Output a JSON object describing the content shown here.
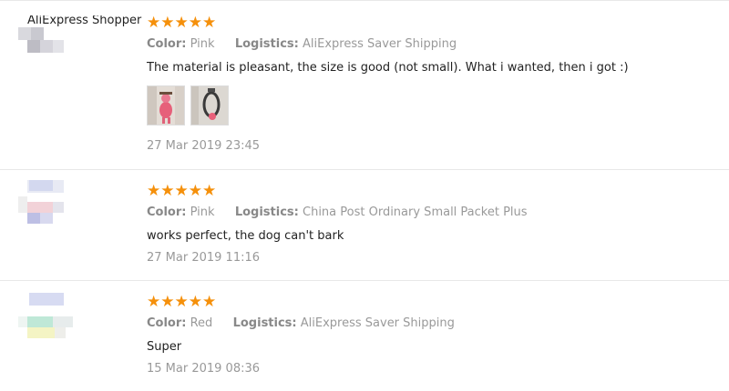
{
  "reviews": [
    {
      "reviewer": "AliExpress Shopper",
      "stars": "★★★★★",
      "color_label": "Color:",
      "color_value": "Pink",
      "logistics_label": "Logistics:",
      "logistics_value": "AliExpress Saver Shipping",
      "text": "The material is pleasant, the size is good (not small). What i wanted, then i got :)",
      "photos": [
        "photo-1",
        "photo-2"
      ],
      "date": "27 Mar 2019 23:45"
    },
    {
      "stars": "★★★★★",
      "color_label": "Color:",
      "color_value": "Pink",
      "logistics_label": "Logistics:",
      "logistics_value": "China Post Ordinary Small Packet Plus",
      "text": "works perfect, the dog can't bark",
      "date": "27 Mar 2019 11:16"
    },
    {
      "stars": "★★★★★",
      "color_label": "Color:",
      "color_value": "Red",
      "logistics_label": "Logistics:",
      "logistics_value": "AliExpress Saver Shipping",
      "text": "Super",
      "date": "15 Mar 2019 08:36"
    }
  ],
  "colors": {
    "star": "#f5900b",
    "meta_text": "#999999",
    "divider": "#e8e8e8"
  },
  "rating": {
    "max": 5,
    "values": [
      5,
      5,
      5
    ]
  }
}
